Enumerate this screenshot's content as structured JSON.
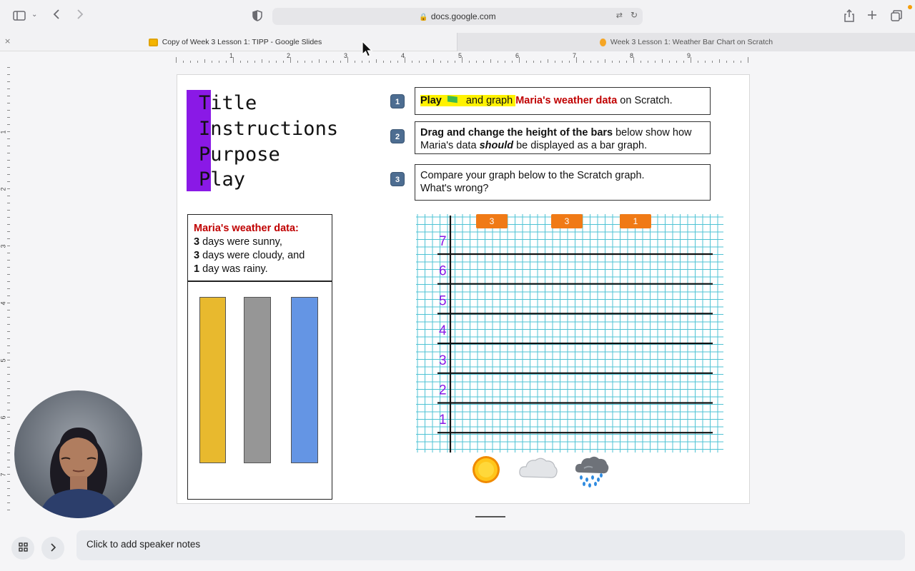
{
  "browser": {
    "url": "docs.google.com",
    "tabs": [
      {
        "label": "Copy of Week 3 Lesson 1: TIPP - Google Slides"
      },
      {
        "label": "Week 3 Lesson 1: Weather Bar Chart on Scratch"
      }
    ],
    "close_glyph": "×"
  },
  "rulers": {
    "horizontal": [
      "1",
      "2",
      "3",
      "4",
      "5",
      "6",
      "7",
      "8",
      "9"
    ],
    "vertical": [
      "1",
      "2",
      "3",
      "4",
      "5",
      "6",
      "7"
    ]
  },
  "slide": {
    "tipp": [
      {
        "letter": "T",
        "rest": "itle"
      },
      {
        "letter": "I",
        "rest": "nstructions"
      },
      {
        "letter": "P",
        "rest": "urpose"
      },
      {
        "letter": "P",
        "rest": "lay"
      }
    ],
    "steps": [
      {
        "num": "1",
        "play": "Play",
        "mid": " and graph ",
        "red": "Maria's weather data",
        "end": " on Scratch."
      },
      {
        "num": "2",
        "bold": "Drag and change the height of the bars",
        "rest1": " below show how Maria's data ",
        "italic": "should",
        "rest2": " be displayed as a bar graph."
      },
      {
        "num": "3",
        "text1": "Compare your graph below to the Scratch graph.",
        "text2": "What's wrong?"
      }
    ],
    "weather_data": {
      "title": "Maria's weather data:",
      "lines": [
        {
          "num": "3",
          "text": " days were sunny,"
        },
        {
          "num": "3",
          "text": " days were cloudy, and"
        },
        {
          "num": "1",
          "text": " day was rainy."
        }
      ]
    },
    "bars": [
      {
        "color": "#e8b92e"
      },
      {
        "color": "#969696"
      },
      {
        "color": "#6495e4"
      }
    ],
    "graph": {
      "y_labels": [
        "7",
        "6",
        "5",
        "4",
        "3",
        "2",
        "1"
      ],
      "count_labels": [
        "3",
        "3",
        "1"
      ],
      "grid_color": "#4fc3d4",
      "label_color": "#8a19e6",
      "tag_color": "#f07a16"
    }
  },
  "notes": {
    "placeholder": "Click to add speaker notes"
  },
  "icons": {
    "sidebar": "sidebar-icon",
    "back": "chevron-left-icon",
    "forward": "chevron-right-icon",
    "shield": "shield-icon",
    "lock": "lock-icon",
    "translate": "translate-icon",
    "reload": "reload-icon",
    "share": "share-icon",
    "new_tab": "plus-icon",
    "tabs_overview": "tabs-icon",
    "grid": "grid-icon",
    "expand": "chevron-right-icon"
  }
}
